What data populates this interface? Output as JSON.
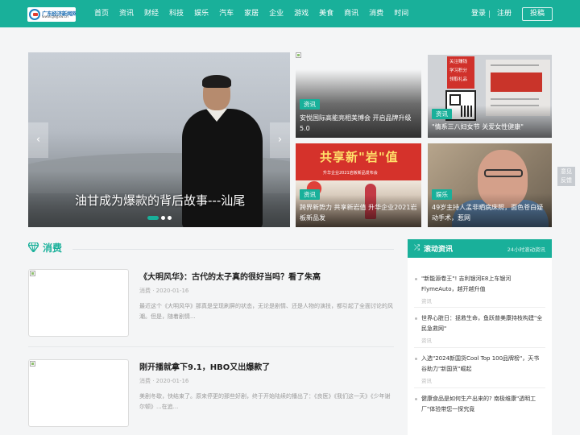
{
  "header": {
    "logo_line1": "广东经济新闻网",
    "logo_line2": "www.gdjjxw.cn",
    "nav": [
      "首页",
      "资讯",
      "财经",
      "科技",
      "娱乐",
      "汽车",
      "家居",
      "企业",
      "游戏",
      "美食",
      "商讯",
      "消费",
      "时间"
    ],
    "login": "登录",
    "register": "注册",
    "submit": "投稿"
  },
  "slider": {
    "title": "油甘成为爆款的背后故事---汕尾",
    "prev": "‹",
    "next": "›"
  },
  "cards": [
    {
      "tag": "资讯",
      "title": "安悦国际高能亮相美博会 开启品牌升级5.0"
    },
    {
      "tag": "资讯",
      "title": "\"情系三八妇女节 关爱女性健康\"",
      "image_text": [
        "关注赚钱",
        "学习积分",
        "领取礼品"
      ]
    },
    {
      "tag": "资讯",
      "title": "跨界新势力 共享新岩值 升华企业2021岩板新品发",
      "image_big": "共享新\"岩\"值",
      "image_small": "升华企业2021岩板新品发布会"
    },
    {
      "tag": "娱乐",
      "title": "49岁主持人孟非晒病床照，面色苍白疑动手术，惹网"
    }
  ],
  "feedback": [
    "意见",
    "反馈"
  ],
  "section": {
    "title": "消费"
  },
  "articles": [
    {
      "title": "《大明风华》：古代的太子真的很好当吗？看了朱高",
      "meta": "消费 · 2020-01-16",
      "summary": "最近这个《大明风华》那真是呈现刷屏的状态，无论是剧情、还是人物的演技，都引起了全面讨论的风潮。但是，随着剧情..."
    },
    {
      "title": "刚开播就拿下9.1，HBO又出爆款了",
      "meta": "消费 · 2020-01-16",
      "summary": "美剧冬歇，快结束了。原来停更的那些好剧，终于开始陆续的播出了：《良医》《我们这一天》《少年谢尔顿》...在追..."
    }
  ],
  "right_panel": {
    "title": "滚动资讯",
    "subtitle": "24小时滚动资讯",
    "items": [
      {
        "title": "\"新能源卷王\"! 吉利银河E8上车银河FlymeAuto，越开越升值",
        "source": "资讯"
      },
      {
        "title": "世界心脏日：拯救生命，鱼跃普美康持枝构建\"全民急救网\"",
        "source": "资讯"
      },
      {
        "title": "入选\"2024新国货Cool Top 100品牌榜\"，天书谷助力\"新国货\"崛起",
        "source": "资讯"
      },
      {
        "title": "健康食品是如何生产出来的? 南极维康\"透明工厂\"体验带您一探究竟",
        "source": ""
      }
    ]
  },
  "colors": {
    "accent": "#19b09a"
  }
}
